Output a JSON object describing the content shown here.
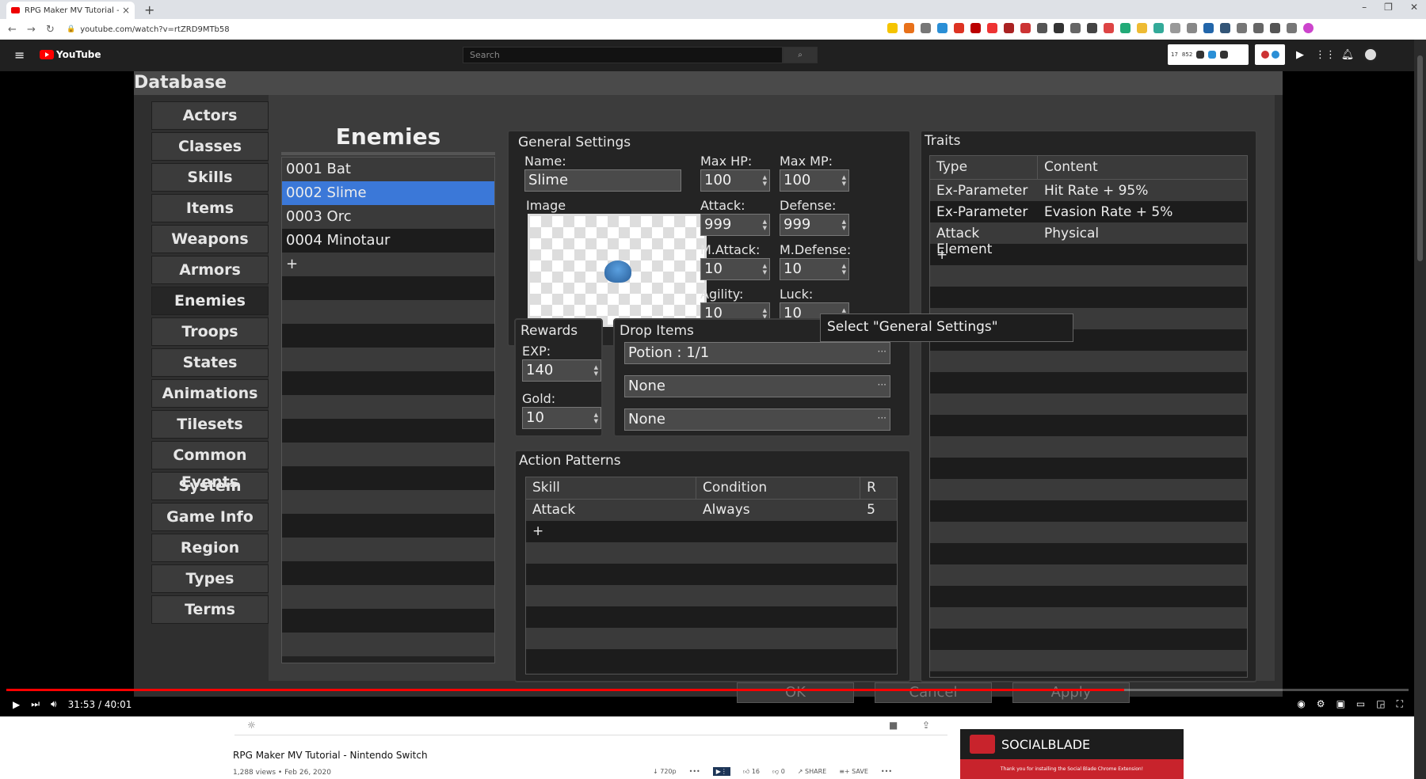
{
  "browser": {
    "tab_title": "RPG Maker MV Tutorial - Ni",
    "url": "youtube.com/watch?v=rtZRD9MTb58"
  },
  "youtube": {
    "logo_text": "YouTube",
    "search_placeholder": "Search",
    "widget_num1": "17",
    "widget_num2": "852"
  },
  "rpg": {
    "window_title": "Database",
    "menu": [
      "Actors",
      "Classes",
      "Skills",
      "Items",
      "Weapons",
      "Armors",
      "Enemies",
      "Troops",
      "States",
      "Animations",
      "Tilesets",
      "Common Events",
      "System",
      "Game Info",
      "Region",
      "Types",
      "Terms"
    ],
    "active_menu": "Enemies",
    "list_title": "Enemies",
    "enemies": [
      "0001 Bat",
      "0002 Slime",
      "0003 Orc",
      "0004 Minotaur"
    ],
    "selected_enemy": "0002 Slime",
    "add_symbol": "+",
    "general": {
      "title": "General Settings",
      "name_label": "Name:",
      "name_value": "Slime",
      "image_label": "Image",
      "max_hp_label": "Max HP:",
      "max_hp": "100",
      "max_mp_label": "Max MP:",
      "max_mp": "100",
      "attack_label": "Attack:",
      "attack": "999",
      "defense_label": "Defense:",
      "defense": "999",
      "mattack_label": "M.Attack:",
      "mattack": "10",
      "mdefense_label": "M.Defense:",
      "mdefense": "10",
      "agility_label": "Agility:",
      "agility": "10",
      "luck_label": "Luck:",
      "luck": "10"
    },
    "tooltip": "Select \"General Settings\"",
    "rewards": {
      "title": "Rewards",
      "exp_label": "EXP:",
      "exp": "140",
      "gold_label": "Gold:",
      "gold": "10"
    },
    "drops": {
      "title": "Drop Items",
      "items": [
        "Potion : 1/1",
        "None",
        "None"
      ]
    },
    "actions": {
      "title": "Action Patterns",
      "headers": [
        "Skill",
        "Condition",
        "R"
      ],
      "rows": [
        {
          "skill": "Attack",
          "condition": "Always",
          "r": "5"
        }
      ]
    },
    "traits": {
      "title": "Traits",
      "headers": [
        "Type",
        "Content"
      ],
      "rows": [
        {
          "type": "Ex-Parameter",
          "content": "Hit Rate + 95%"
        },
        {
          "type": "Ex-Parameter",
          "content": "Evasion Rate + 5%"
        },
        {
          "type": "Attack Element",
          "content": "Physical"
        }
      ]
    },
    "buttons": {
      "ok": "OK",
      "cancel": "Cancel",
      "apply": "Apply"
    }
  },
  "player": {
    "time": "31:53 / 40:01",
    "progress": 0.797
  },
  "page": {
    "video_title": "RPG Maker MV Tutorial - Nintendo Switch",
    "meta": "1,288 views • Feb 26, 2020",
    "quality": "720p",
    "likes": "16",
    "dislikes": "0",
    "share": "SHARE",
    "save": "SAVE"
  },
  "socialblade": {
    "title": "SOCIALBLADE",
    "tagline": "Thank you for installing the Social Blade Chrome Extension!"
  },
  "colors": {
    "selection": "#3b78d8",
    "yt_red": "#ff0000",
    "socialblade_red": "#c8232c"
  }
}
